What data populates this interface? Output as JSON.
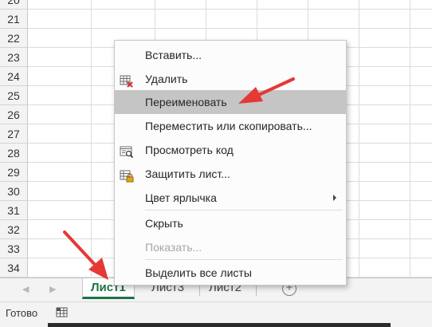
{
  "rows": [
    "20",
    "21",
    "22",
    "23",
    "24",
    "25",
    "26",
    "27",
    "28",
    "29",
    "30",
    "31",
    "32",
    "33",
    "34"
  ],
  "context_menu": {
    "items": [
      {
        "label": "Вставить...",
        "icon": "",
        "disabled": false,
        "hover": false
      },
      {
        "label": "Удалить",
        "icon": "delete-sheet-icon",
        "disabled": false,
        "hover": false
      },
      {
        "label": "Переименовать",
        "icon": "",
        "disabled": false,
        "hover": true
      },
      {
        "label": "Переместить или скопировать...",
        "icon": "",
        "disabled": false,
        "hover": false
      },
      {
        "label": "Просмотреть код",
        "icon": "view-code-icon",
        "disabled": false,
        "hover": false
      },
      {
        "label": "Защитить лист...",
        "icon": "protect-sheet-icon",
        "disabled": false,
        "hover": false
      },
      {
        "label": "Цвет ярлычка",
        "icon": "",
        "disabled": false,
        "hover": false,
        "submenu": true
      },
      {
        "label": "Скрыть",
        "icon": "",
        "disabled": false,
        "hover": false
      },
      {
        "label": "Показать...",
        "icon": "",
        "disabled": true,
        "hover": false
      },
      {
        "label": "Выделить все листы",
        "icon": "",
        "disabled": false,
        "hover": false
      }
    ]
  },
  "tabs": [
    {
      "label": "Лист1",
      "active": true
    },
    {
      "label": "Лист3",
      "active": false
    },
    {
      "label": "Лист2",
      "active": false
    }
  ],
  "status": {
    "text": "Готово"
  },
  "colors": {
    "accent": "#1e7145",
    "arrow": "#e53935",
    "hover": "#c5c5c5"
  }
}
